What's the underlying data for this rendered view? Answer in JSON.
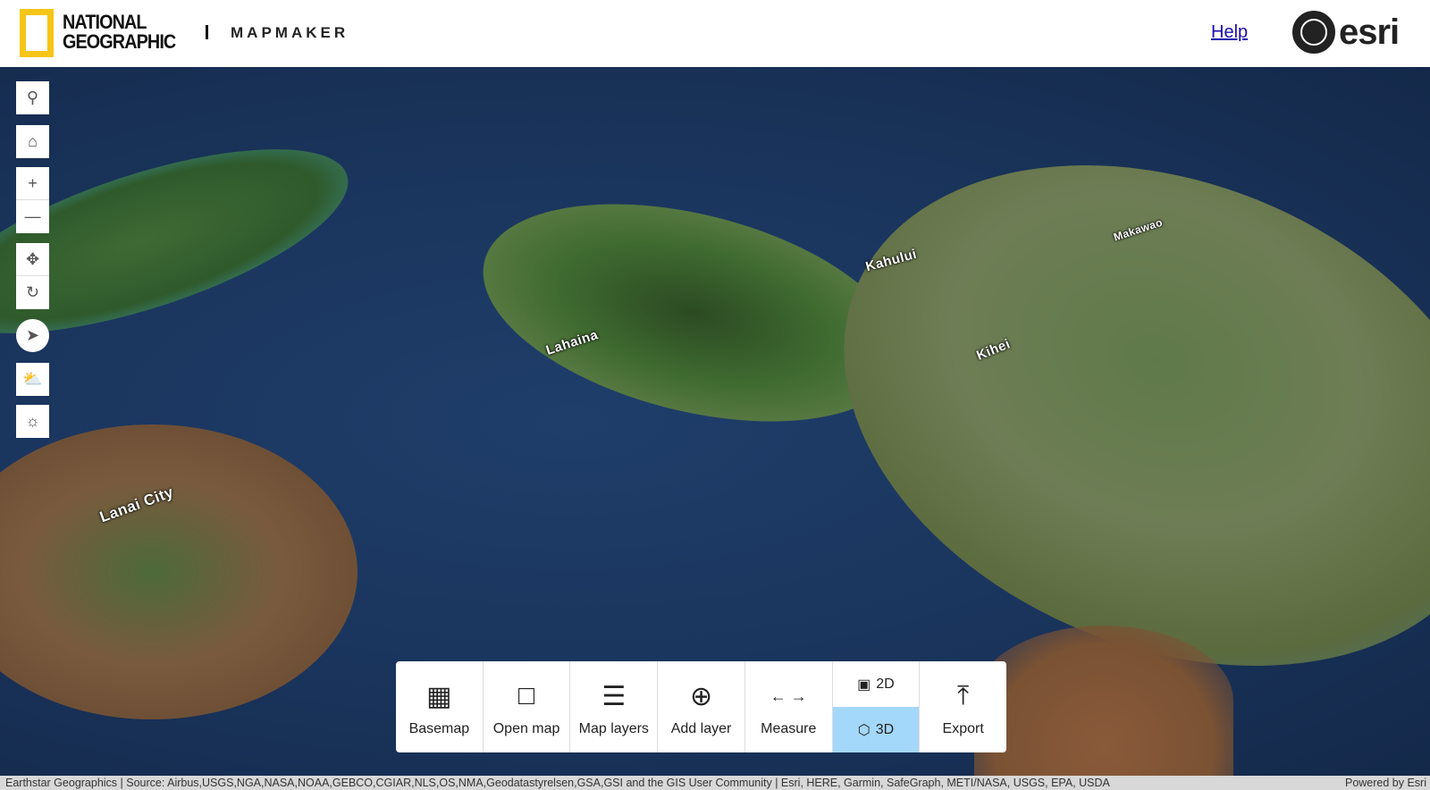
{
  "header": {
    "brand": "NATIONAL GEOGRAPHIC",
    "brand_line1": "NATIONAL",
    "brand_line2": "GEOGRAPHIC",
    "product": "MAPMAKER",
    "help": "Help",
    "partner": "esri"
  },
  "map": {
    "labels": [
      "Lahaina",
      "Kahului",
      "Makawao",
      "Kihei",
      "Lanai City"
    ]
  },
  "tools": [
    {
      "name": "search-icon"
    },
    {
      "name": "home-icon"
    },
    {
      "name": "zoom-in-icon"
    },
    {
      "name": "zoom-out-icon"
    },
    {
      "name": "pan-icon"
    },
    {
      "name": "rotate-icon"
    },
    {
      "name": "compass-icon"
    },
    {
      "name": "weather-icon"
    },
    {
      "name": "daylight-icon"
    }
  ],
  "toolbar": {
    "basemap": "Basemap",
    "open_map": "Open map",
    "map_layers": "Map layers",
    "add_layer": "Add layer",
    "measure": "Measure",
    "view_2d": "2D",
    "view_3d": "3D",
    "export": "Export",
    "active_view": "3D"
  },
  "attribution": {
    "text": "Earthstar Geographics | Source: Airbus,USGS,NGA,NASA,NOAA,GEBCO,CGIAR,NLS,OS,NMA,Geodatastyrelsen,GSA,GSI and the GIS User Community | Esri, HERE, Garmin, SafeGraph, METI/NASA, USGS, EPA, USDA",
    "powered": "Powered by Esri"
  },
  "colors": {
    "active_view": "#a3d8fa",
    "ng_yellow": "#f5c518"
  }
}
